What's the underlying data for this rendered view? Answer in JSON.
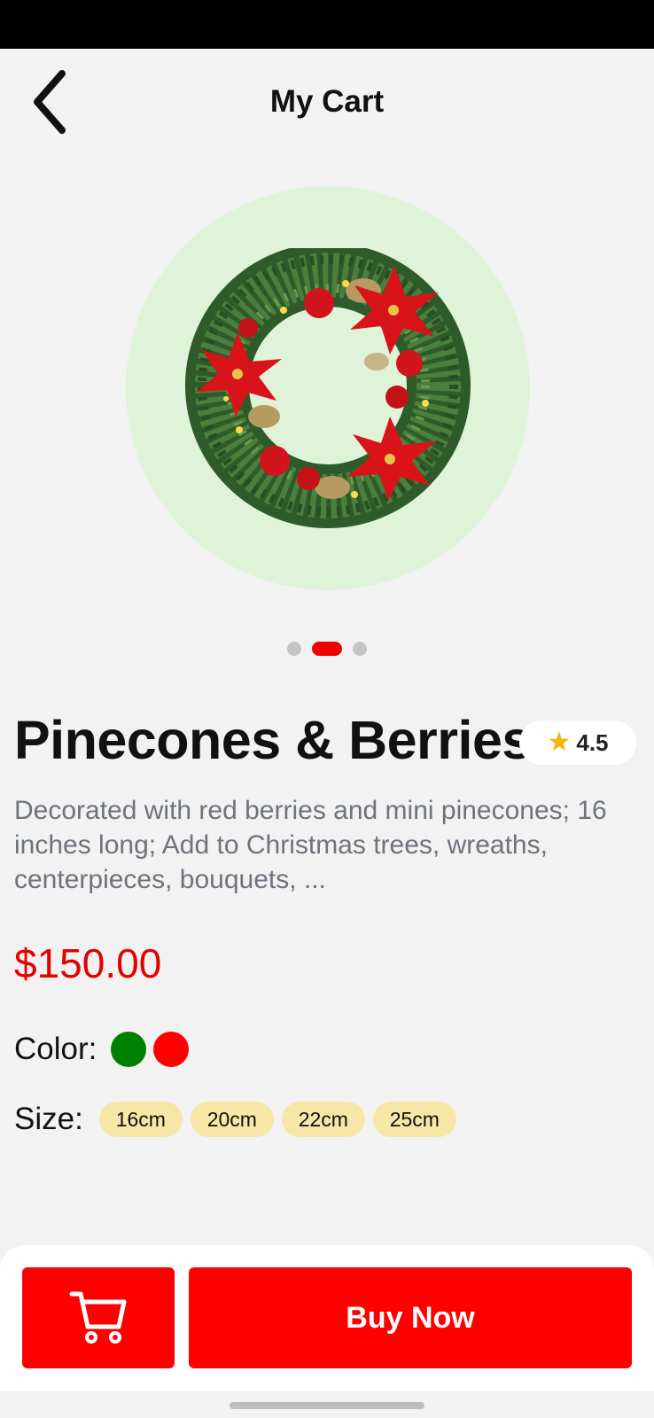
{
  "header": {
    "title": "My Cart",
    "back_icon": "chevron-left-icon"
  },
  "carousel": {
    "slide_count": 3,
    "active_index": 1,
    "active_color": "#ee0000",
    "image": "christmas-wreath"
  },
  "product": {
    "title": "Pinecones & Berries",
    "rating": "4.5",
    "rating_icon": "star-icon",
    "description": "Decorated with red berries and mini pinecones; 16 inches long; Add to Christmas trees, wreaths, centerpieces, bouquets, ...",
    "price": "$150.00"
  },
  "options": {
    "color_label": "Color:",
    "colors": [
      "#008000",
      "#ff0000"
    ],
    "size_label": "Size:",
    "sizes": [
      "16cm",
      "20cm",
      "22cm",
      "25cm"
    ]
  },
  "actions": {
    "cart_icon": "cart-icon",
    "buy_label": "Buy Now",
    "accent": "#ff0000"
  }
}
